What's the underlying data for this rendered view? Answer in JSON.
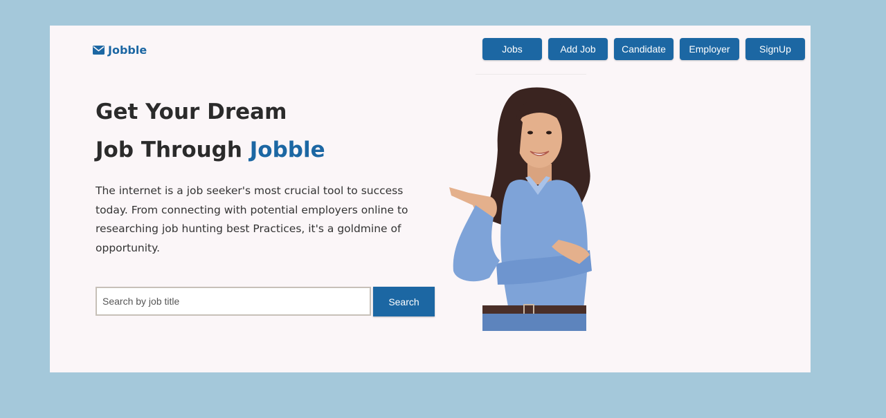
{
  "brand": {
    "name": "Jobble",
    "icon": "envelope-icon"
  },
  "nav": {
    "items": [
      {
        "label": "Jobs"
      },
      {
        "label": "Add Job"
      },
      {
        "label": "Candidate"
      },
      {
        "label": "Employer"
      },
      {
        "label": "SignUp"
      }
    ]
  },
  "hero": {
    "headline_line1": "Get Your Dream",
    "headline_line2_prefix": "Job Through ",
    "headline_accent": "Jobble",
    "description": "The internet is a job seeker's most crucial tool to success today. From connecting with potential employers online to researching job hunting best Practices, it's a goldmine of opportunity."
  },
  "search": {
    "placeholder": "Search by job title",
    "value": "",
    "button_label": "Search"
  },
  "colors": {
    "page_background": "#a4c8da",
    "card_background": "#fbf6f8",
    "accent": "#1c67a3",
    "text": "#2b2b2b"
  }
}
